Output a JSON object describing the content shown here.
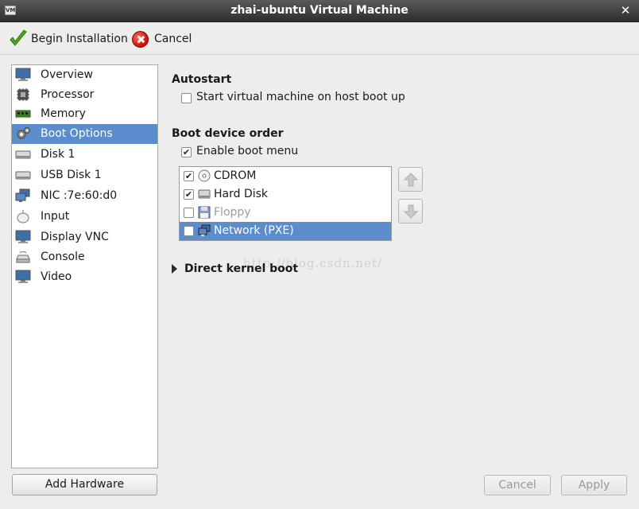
{
  "window": {
    "title": "zhai-ubuntu Virtual Machine",
    "close_glyph": "✕",
    "app_icon": "vm"
  },
  "toolbar": {
    "begin_label": "Begin Installation",
    "cancel_label": "Cancel"
  },
  "sidebar": {
    "items": [
      {
        "label": "Overview",
        "icon": "monitor-icon"
      },
      {
        "label": "Processor",
        "icon": "cpu-icon"
      },
      {
        "label": "Memory",
        "icon": "memory-icon"
      },
      {
        "label": "Boot Options",
        "icon": "gear-icon",
        "selected": true
      },
      {
        "label": "Disk 1",
        "icon": "disk-icon"
      },
      {
        "label": "USB Disk 1",
        "icon": "disk-icon"
      },
      {
        "label": "NIC :7e:60:d0",
        "icon": "network-icon"
      },
      {
        "label": "Input",
        "icon": "mouse-icon"
      },
      {
        "label": "Display VNC",
        "icon": "monitor-icon"
      },
      {
        "label": "Console",
        "icon": "console-icon"
      },
      {
        "label": "Video",
        "icon": "monitor-icon"
      }
    ],
    "add_hardware_label": "Add Hardware"
  },
  "autostart": {
    "heading": "Autostart",
    "checkbox_label": "Start virtual machine on host boot up",
    "checked": false
  },
  "boot_order": {
    "heading": "Boot device order",
    "enable_menu_label": "Enable boot menu",
    "enable_menu_checked": true,
    "devices": [
      {
        "label": "CDROM",
        "checked": true,
        "icon": "cdrom-icon"
      },
      {
        "label": "Hard Disk",
        "checked": true,
        "icon": "harddisk-icon"
      },
      {
        "label": "Floppy",
        "checked": false,
        "icon": "floppy-icon",
        "dimmed": true
      },
      {
        "label": "Network (PXE)",
        "checked": false,
        "icon": "network-icon",
        "selected": true
      }
    ]
  },
  "direct_kernel": {
    "label": "Direct kernel boot",
    "expanded": false
  },
  "watermark": "http://blog.csdn.net/",
  "footer": {
    "cancel_label": "Cancel",
    "apply_label": "Apply"
  },
  "check_glyph": "✔",
  "colors": {
    "selection": "#5b8ccb",
    "titlebar": "#3a3a3a"
  }
}
